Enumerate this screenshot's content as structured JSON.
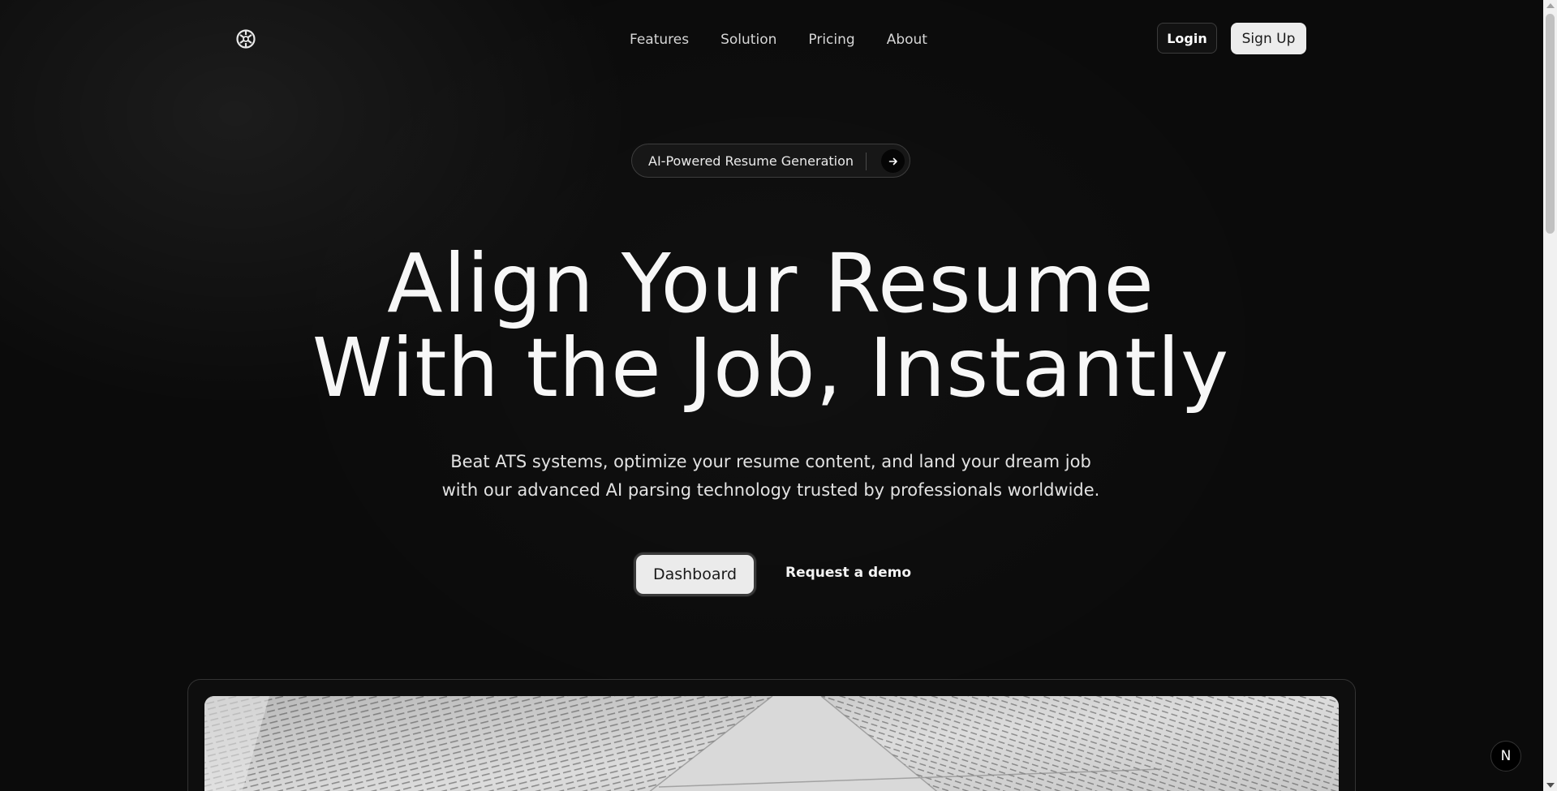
{
  "header": {
    "logo_icon": "aperture-logo-icon",
    "nav": [
      {
        "label": "Features"
      },
      {
        "label": "Solution"
      },
      {
        "label": "Pricing"
      },
      {
        "label": "About"
      }
    ],
    "login_label": "Login",
    "signup_label": "Sign Up"
  },
  "badge": {
    "text": "AI-Powered Resume Generation",
    "icon": "arrow-right-icon"
  },
  "hero": {
    "title_line1": "Align Your Resume",
    "title_line2": "With the Job, Instantly",
    "subtitle_line1": "Beat ATS systems, optimize your resume content, and land your dream job",
    "subtitle_line2": "with our advanced AI parsing technology trusted by professionals worldwide."
  },
  "cta": {
    "primary_label": "Dashboard",
    "secondary_label": "Request a demo"
  },
  "floating": {
    "next_badge_label": "N"
  },
  "colors": {
    "background": "#0b0b0b",
    "text": "#f7f7f7",
    "button_light": "#ececec"
  }
}
